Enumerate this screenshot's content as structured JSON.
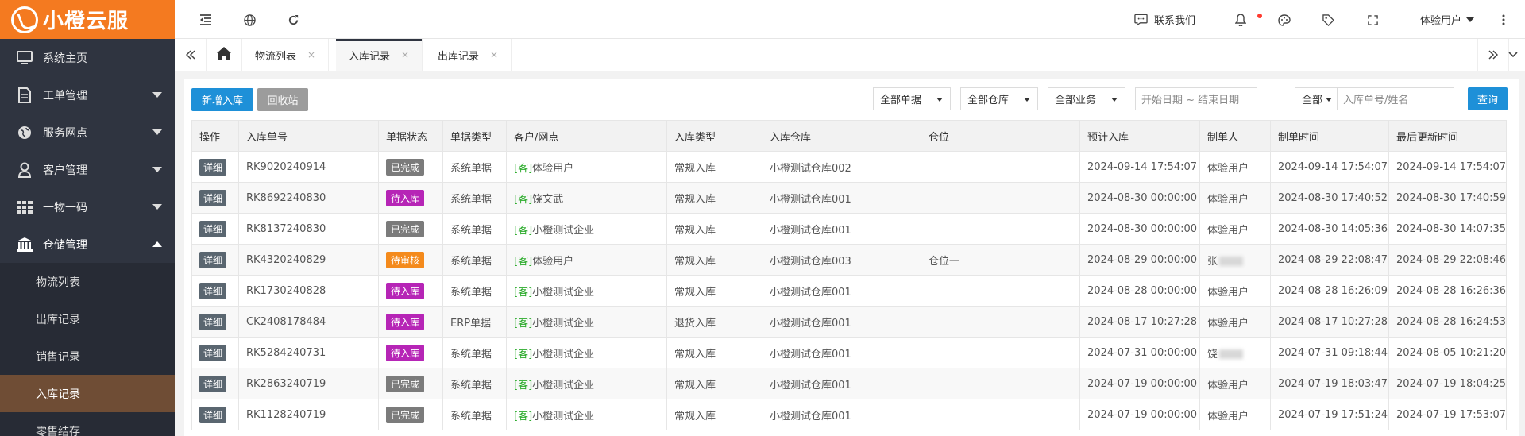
{
  "brand": {
    "name": "小橙云服",
    "color": "#f47a20"
  },
  "sidebar": {
    "items": [
      {
        "label": "系统主页",
        "icon": "monitor-icon"
      },
      {
        "label": "工单管理",
        "icon": "document-icon"
      },
      {
        "label": "服务网点",
        "icon": "globe-icon"
      },
      {
        "label": "客户管理",
        "icon": "user-icon"
      },
      {
        "label": "一物一码",
        "icon": "grid-icon"
      },
      {
        "label": "仓储管理",
        "icon": "bank-icon"
      }
    ],
    "sub_items": [
      {
        "label": "物流列表"
      },
      {
        "label": "出库记录"
      },
      {
        "label": "销售记录"
      },
      {
        "label": "入库记录"
      },
      {
        "label": "零售结存"
      }
    ]
  },
  "header": {
    "contact_label": "联系我们",
    "user_label": "体验用户"
  },
  "tabs": [
    {
      "label": "物流列表",
      "close": "×"
    },
    {
      "label": "入库记录",
      "close": "×"
    },
    {
      "label": "出库记录",
      "close": "×"
    }
  ],
  "toolbar": {
    "add_label": "新增入库",
    "recycle_label": "回收站",
    "filter_doc": "全部单据",
    "filter_warehouse": "全部仓库",
    "filter_business": "全部业务",
    "date_placeholder": "开始日期 ~ 结束日期",
    "search_scope": "全部",
    "search_placeholder": "入库单号/姓名",
    "query_label": "查询"
  },
  "table": {
    "headers": [
      "操作",
      "入库单号",
      "单据状态",
      "单据类型",
      "客户/网点",
      "入库类型",
      "入库仓库",
      "仓位",
      "预计入库",
      "制单人",
      "制单时间",
      "最后更新时间"
    ],
    "detail_label": "详细",
    "customer_prefix": "[客]",
    "status_colors": {
      "已完成": "#7b7b7b",
      "待入库": "#b625b6",
      "待审核": "#f48a1c"
    },
    "rows": [
      {
        "no": "RK9020240914",
        "status": "已完成",
        "doc_type": "系统单据",
        "customer": "体验用户",
        "in_type": "常规入库",
        "warehouse": "小橙测试仓库002",
        "location": "",
        "expected": "2024-09-14 17:54:07",
        "creator": "体验用户",
        "created": "2024-09-14 17:54:07",
        "updated": "2024-09-14 17:54:07"
      },
      {
        "no": "RK8692240830",
        "status": "待入库",
        "doc_type": "系统单据",
        "customer": "饶文武",
        "in_type": "常规入库",
        "warehouse": "小橙测试仓库001",
        "location": "",
        "expected": "2024-08-30 00:00:00",
        "creator": "体验用户",
        "created": "2024-08-30 17:40:52",
        "updated": "2024-08-30 17:40:59"
      },
      {
        "no": "RK8137240830",
        "status": "已完成",
        "doc_type": "系统单据",
        "customer": "小橙测试企业",
        "in_type": "常规入库",
        "warehouse": "小橙测试仓库001",
        "location": "",
        "expected": "2024-08-30 00:00:00",
        "creator": "体验用户",
        "created": "2024-08-30 14:05:36",
        "updated": "2024-08-30 14:07:35"
      },
      {
        "no": "RK4320240829",
        "status": "待审核",
        "doc_type": "系统单据",
        "customer": "体验用户",
        "in_type": "常规入库",
        "warehouse": "小橙测试仓库003",
        "location": "仓位一",
        "expected": "2024-08-29 00:00:00",
        "creator": "张",
        "creator_blurred": true,
        "created": "2024-08-29 22:08:47",
        "updated": "2024-08-29 22:08:46"
      },
      {
        "no": "RK1730240828",
        "status": "待入库",
        "doc_type": "系统单据",
        "customer": "小橙测试企业",
        "in_type": "常规入库",
        "warehouse": "小橙测试仓库001",
        "location": "",
        "expected": "2024-08-28 00:00:00",
        "creator": "体验用户",
        "created": "2024-08-28 16:26:09",
        "updated": "2024-08-28 16:26:36"
      },
      {
        "no": "CK2408178484",
        "status": "待入库",
        "doc_type": "ERP单据",
        "customer": "小橙测试企业",
        "in_type": "退货入库",
        "warehouse": "小橙测试仓库001",
        "location": "",
        "expected": "2024-08-17 10:27:28",
        "creator": "体验用户",
        "created": "2024-08-17 10:27:28",
        "updated": "2024-08-28 16:24:53"
      },
      {
        "no": "RK5284240731",
        "status": "待入库",
        "doc_type": "系统单据",
        "customer": "小橙测试企业",
        "in_type": "常规入库",
        "warehouse": "小橙测试仓库001",
        "location": "",
        "expected": "2024-07-31 00:00:00",
        "creator": "饶",
        "creator_blurred": true,
        "created": "2024-07-31 09:18:44",
        "updated": "2024-08-05 10:21:20"
      },
      {
        "no": "RK2863240719",
        "status": "已完成",
        "doc_type": "系统单据",
        "customer": "小橙测试企业",
        "in_type": "常规入库",
        "warehouse": "小橙测试仓库001",
        "location": "",
        "expected": "2024-07-19 00:00:00",
        "creator": "体验用户",
        "created": "2024-07-19 18:03:47",
        "updated": "2024-07-19 18:04:25"
      },
      {
        "no": "RK1128240719",
        "status": "已完成",
        "doc_type": "系统单据",
        "customer": "小橙测试企业",
        "in_type": "常规入库",
        "warehouse": "小橙测试仓库001",
        "location": "",
        "expected": "2024-07-19 00:00:00",
        "creator": "体验用户",
        "created": "2024-07-19 17:51:24",
        "updated": "2024-07-19 17:53:07"
      }
    ]
  }
}
